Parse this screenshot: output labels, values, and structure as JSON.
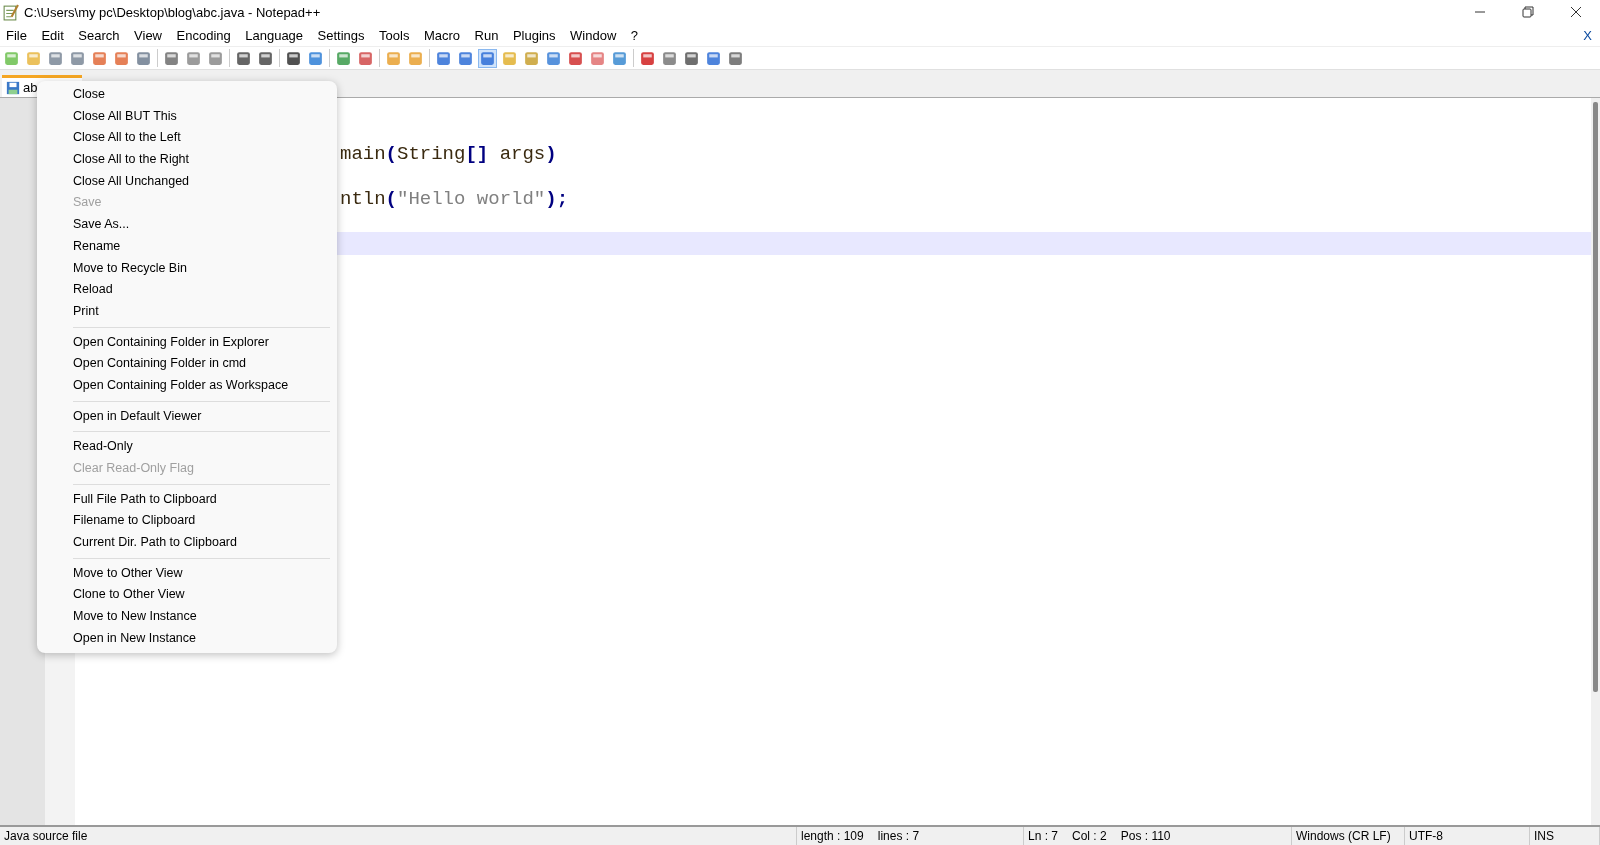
{
  "window": {
    "title": "C:\\Users\\my pc\\Desktop\\blog\\abc.java - Notepad++"
  },
  "menubar": {
    "items": [
      "File",
      "Edit",
      "Search",
      "View",
      "Encoding",
      "Language",
      "Settings",
      "Tools",
      "Macro",
      "Run",
      "Plugins",
      "Window",
      "?"
    ],
    "close_doc": "X"
  },
  "tabs": [
    {
      "label": "ab",
      "selected": true
    }
  ],
  "editor": {
    "lines": [
      {
        "current": false
      },
      {
        "current": false
      },
      {
        "current": false,
        "segments": [
          {
            "kind": "ident",
            "text": "main"
          },
          {
            "kind": "op",
            "text": "("
          },
          {
            "kind": "ident",
            "text": "String"
          },
          {
            "kind": "op",
            "text": "[]"
          },
          {
            "kind": "ident",
            "text": " args"
          },
          {
            "kind": "op",
            "text": ")"
          }
        ]
      },
      {
        "current": false
      },
      {
        "current": false,
        "segments": [
          {
            "kind": "ident",
            "text": "ntln"
          },
          {
            "kind": "op",
            "text": "("
          },
          {
            "kind": "string",
            "text": "\"Hello world\""
          },
          {
            "kind": "op",
            "text": ");"
          }
        ]
      },
      {
        "current": false
      },
      {
        "current": true
      }
    ]
  },
  "context_menu": {
    "groups": [
      [
        {
          "label": "Close",
          "disabled": false
        },
        {
          "label": "Close All BUT This",
          "disabled": false
        },
        {
          "label": "Close All to the Left",
          "disabled": false
        },
        {
          "label": "Close All to the Right",
          "disabled": false
        },
        {
          "label": "Close All Unchanged",
          "disabled": false
        },
        {
          "label": "Save",
          "disabled": true
        },
        {
          "label": "Save As...",
          "disabled": false
        },
        {
          "label": "Rename",
          "disabled": false
        },
        {
          "label": "Move to Recycle Bin",
          "disabled": false
        },
        {
          "label": "Reload",
          "disabled": false
        },
        {
          "label": "Print",
          "disabled": false
        }
      ],
      [
        {
          "label": "Open Containing Folder in Explorer",
          "disabled": false
        },
        {
          "label": "Open Containing Folder in cmd",
          "disabled": false
        },
        {
          "label": "Open Containing Folder as Workspace",
          "disabled": false
        }
      ],
      [
        {
          "label": "Open in Default Viewer",
          "disabled": false
        }
      ],
      [
        {
          "label": "Read-Only",
          "disabled": false
        },
        {
          "label": "Clear Read-Only Flag",
          "disabled": true
        }
      ],
      [
        {
          "label": "Full File Path to Clipboard",
          "disabled": false
        },
        {
          "label": "Filename to Clipboard",
          "disabled": false
        },
        {
          "label": "Current Dir. Path to Clipboard",
          "disabled": false
        }
      ],
      [
        {
          "label": "Move to Other View",
          "disabled": false
        },
        {
          "label": "Clone to Other View",
          "disabled": false
        },
        {
          "label": "Move to New Instance",
          "disabled": false
        },
        {
          "label": "Open in New Instance",
          "disabled": false
        }
      ]
    ]
  },
  "status_bar": {
    "file_type": "Java source file",
    "length": "length : 109",
    "lines": "lines : 7",
    "ln": "Ln : 7",
    "col": "Col : 2",
    "pos": "Pos : 110",
    "eol": "Windows (CR LF)",
    "encoding": "UTF-8",
    "mode": "INS"
  }
}
